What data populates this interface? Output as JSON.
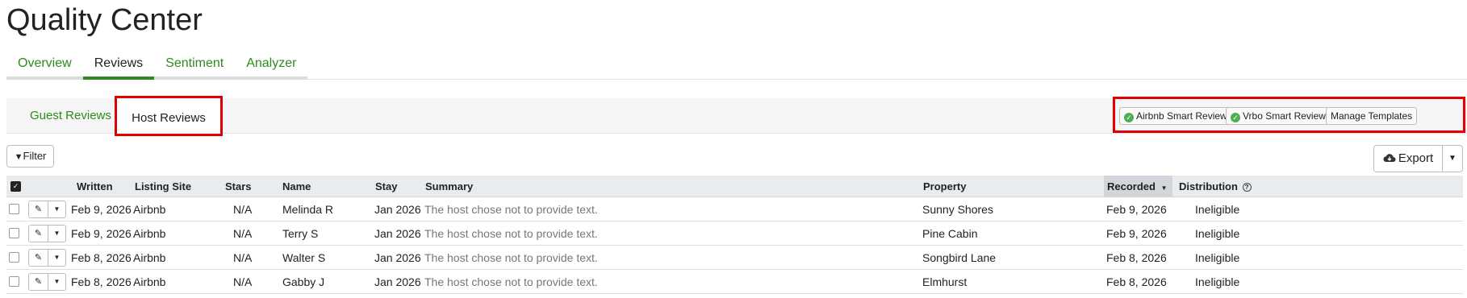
{
  "page_title": "Quality Center",
  "top_tabs": [
    {
      "label": "Overview"
    },
    {
      "label": "Reviews"
    },
    {
      "label": "Sentiment"
    },
    {
      "label": "Analyzer"
    }
  ],
  "sub_tabs": [
    {
      "label": "Guest Reviews"
    },
    {
      "label": "Host Reviews"
    }
  ],
  "actions": {
    "airbnb_smart": "Airbnb Smart Reviews",
    "vrbo_smart": "Vrbo Smart Reviews",
    "manage_templates": "Manage Templates"
  },
  "toolbar": {
    "filter_label": "Filter",
    "export_label": "Export"
  },
  "table": {
    "headers": {
      "written": "Written",
      "listing_site": "Listing Site",
      "stars": "Stars",
      "name": "Name",
      "stay": "Stay",
      "summary": "Summary",
      "property": "Property",
      "recorded": "Recorded",
      "distribution": "Distribution"
    },
    "rows": [
      {
        "written": "Feb 9, 2026",
        "listing_site": "Airbnb",
        "stars": "N/A",
        "name": "Melinda R",
        "stay": "Jan 2026",
        "summary": "The host chose not to provide text.",
        "property": "Sunny Shores",
        "recorded": "Feb 9, 2026",
        "distribution": "Ineligible"
      },
      {
        "written": "Feb 9, 2026",
        "listing_site": "Airbnb",
        "stars": "N/A",
        "name": "Terry S",
        "stay": "Jan 2026",
        "summary": "The host chose not to provide text.",
        "property": "Pine Cabin",
        "recorded": "Feb 9, 2026",
        "distribution": "Ineligible"
      },
      {
        "written": "Feb 8, 2026",
        "listing_site": "Airbnb",
        "stars": "N/A",
        "name": "Walter S",
        "stay": "Jan 2026",
        "summary": "The host chose not to provide text.",
        "property": "Songbird Lane",
        "recorded": "Feb 8, 2026",
        "distribution": "Ineligible"
      },
      {
        "written": "Feb 8, 2026",
        "listing_site": "Airbnb",
        "stars": "N/A",
        "name": "Gabby J",
        "stay": "Jan 2026",
        "summary": "The host chose not to provide text.",
        "property": "Elmhurst",
        "recorded": "Feb 8, 2026",
        "distribution": "Ineligible"
      }
    ]
  },
  "colors": {
    "accent_green": "#2e8b1f",
    "highlight_red": "#e00000",
    "check_green": "#4caf50"
  }
}
